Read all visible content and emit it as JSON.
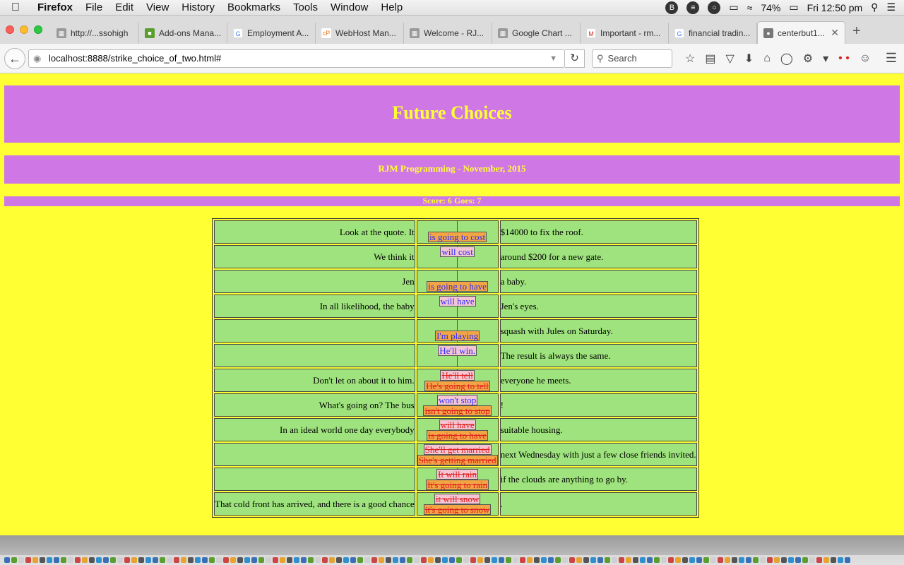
{
  "menubar": {
    "app": "Firefox",
    "items": [
      "File",
      "Edit",
      "View",
      "History",
      "Bookmarks",
      "Tools",
      "Window",
      "Help"
    ],
    "battery": "74%",
    "clock": "Fri 12:50 pm"
  },
  "tabs": [
    {
      "label": "http://...ssohigh"
    },
    {
      "label": "Add-ons Mana..."
    },
    {
      "label": "Employment A..."
    },
    {
      "label": "WebHost Man..."
    },
    {
      "label": "Welcome - RJ..."
    },
    {
      "label": "Google Chart ..."
    },
    {
      "label": "Important - rm..."
    },
    {
      "label": "financial tradin..."
    },
    {
      "label": "centerbut1..."
    }
  ],
  "nav": {
    "url_host": "localhost",
    "url_rest": ":8888/strike_choice_of_two.html#",
    "search_placeholder": "Search"
  },
  "page": {
    "title": "Future Choices",
    "subtitle": "RJM Programming - November, 2015",
    "score": "Score: 6 Goes: 7"
  },
  "rows": [
    {
      "pre": "Look at the quote. It",
      "post": "$14000 to fix the roof.",
      "pos": "low",
      "chips": [
        {
          "text": "is going to cost",
          "style": "orange",
          "struck": false
        }
      ]
    },
    {
      "pre": "We think it",
      "post": "around $200 for a new gate.",
      "pos": "high",
      "chips": [
        {
          "text": "will cost",
          "style": "pink",
          "struck": false
        }
      ]
    },
    {
      "pre": "Jen",
      "post": "a baby.",
      "pos": "low",
      "chips": [
        {
          "text": "is going to have",
          "style": "orange",
          "struck": false
        }
      ]
    },
    {
      "pre": "In all likelihood, the baby",
      "post": "Jen's eyes.",
      "pos": "high",
      "chips": [
        {
          "text": "will have",
          "style": "pink",
          "struck": false
        }
      ]
    },
    {
      "pre": "",
      "post": "squash with Jules on Saturday.",
      "pos": "low",
      "chips": [
        {
          "text": "I'm playing",
          "style": "orange",
          "struck": false
        }
      ]
    },
    {
      "pre": "",
      "post": "The result is always the same.",
      "pos": "high",
      "chips": [
        {
          "text": "He'll win.",
          "style": "pink",
          "struck": false
        }
      ]
    },
    {
      "pre": "Don't let on about it to him.",
      "post": "everyone he meets.",
      "pos": "mid",
      "chips": [
        {
          "text": "He'll tell",
          "style": "pink",
          "struck": true
        },
        {
          "text": "He's going to tell",
          "style": "orange",
          "struck": true
        }
      ]
    },
    {
      "pre": "What's going on? The bus",
      "post": "!",
      "pos": "mid",
      "chips": [
        {
          "text": "won't stop",
          "style": "pink",
          "struck": false
        },
        {
          "text": "isn't going to stop",
          "style": "orange",
          "struck": true
        }
      ]
    },
    {
      "pre": "In an ideal world one day everybody",
      "post": "suitable housing.",
      "pos": "mid",
      "chips": [
        {
          "text": "will have",
          "style": "pink",
          "struck": true
        },
        {
          "text": "is going to have",
          "style": "orange",
          "struck": true
        }
      ]
    },
    {
      "pre": "",
      "post": "next Wednesday with just a few close friends invited.",
      "pos": "mid",
      "chips": [
        {
          "text": "She'll get married",
          "style": "pink",
          "struck": true
        },
        {
          "text": "She's getting married",
          "style": "orange",
          "struck": true
        }
      ]
    },
    {
      "pre": "",
      "post": "if the clouds are anything to go by.",
      "pos": "mid",
      "chips": [
        {
          "text": "It will rain",
          "style": "pink",
          "struck": true
        },
        {
          "text": "It's going to rain",
          "style": "orange",
          "struck": true
        }
      ]
    },
    {
      "pre": "That cold front has arrived, and there is a good chance",
      "post": ".",
      "pos": "mid",
      "chips": [
        {
          "text": "it will snow",
          "style": "pink",
          "struck": true
        },
        {
          "text": "it's going to snow",
          "style": "orange",
          "struck": true
        }
      ]
    }
  ]
}
